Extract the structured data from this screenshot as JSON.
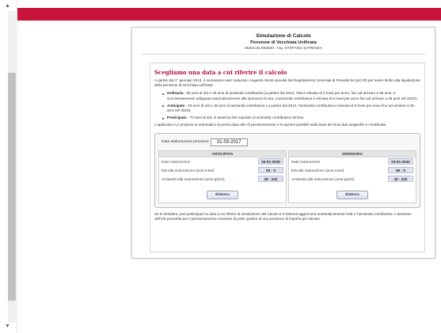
{
  "header": {
    "title": "Simulazione di Calcolo",
    "subtitle": "Pensione di Vecchiaia Unificata",
    "matricola": "Matricola 693630 - Ing. STEFANO SAPIENZA"
  },
  "section": {
    "heading": "Scegliamo una data a cui riferire il calcolo",
    "intro": "A partire dal 1° gennaio 2013, è necessario aver maturato i requisiti minimi previsti dal Regolamento Generale di Previdenza (art.20) per avere diritto alla liquidazione della pensione di vecchiaia unificata:",
    "options": [
      {
        "name": "Ordinaria",
        "text": " - 65 anni di età e 30 anni di anzianità contributiva (a partire dal 2014, l'età è elevata di 3 mesi per anno, fino ad arrivare a 66 anni, e successivamente adeguata automaticamente alla speranza di vita. L'anzianità contributiva è elevata di 6 mesi per anno fino ad arrivare a 35 anni nel 2023);"
      },
      {
        "name": "Anticipata",
        "text": " - 63 anni di età e 30 anni di anzianità contributiva ( a partire dal 2014, l'anzianità contributiva è elevata di 6 mesi per anno fino ad arrivare a 35 anni nel 2023);"
      },
      {
        "name": "Posticipata",
        "text": " - 70 anni di età, in assenza del requisito di anzianità contributiva minima."
      }
    ],
    "note": "L'applicativo Le propone in automatico la prima data utile di pensionamento e le opzioni possibili sulla base dei Suoi dati anagrafici e contributivi."
  },
  "calc": {
    "date_label": "Data elaborazione pensione",
    "date_value": "31-03-2017",
    "anticipata": {
      "head": "ANTICIPATA",
      "rows": [
        {
          "k": "Data maturazione",
          "v": "04-01-2039"
        },
        {
          "k": "Età alla maturazione (anni-mesi)",
          "v": "63 - 0"
        },
        {
          "k": "Anzianità alla maturazione (anni-giorni)",
          "v": "39 - 242"
        }
      ],
      "button": "Elabora"
    },
    "ordinaria": {
      "head": "ORDINARIA",
      "rows": [
        {
          "k": "Data maturazione",
          "v": "04-01-2042"
        },
        {
          "k": "Età alla maturazione (anni-mesi)",
          "v": "66 - 0"
        },
        {
          "k": "Anzianità alla maturazione (anni-giorni)",
          "v": "42 - 242"
        }
      ],
      "button": "Elabora"
    }
  },
  "footer": {
    "text": "Se lo desidera, può posticipare la data a cui riferire la simulazione del calcolo e il sistema aggiornerà automaticamente l'età e l'anzianità contributiva. L'aumento dell'età prescelta per il pensionamento consente di poter godere di una pensione di importo più elevato."
  },
  "colors": {
    "topbar": "#c8133a",
    "heading": "#b0123a"
  }
}
